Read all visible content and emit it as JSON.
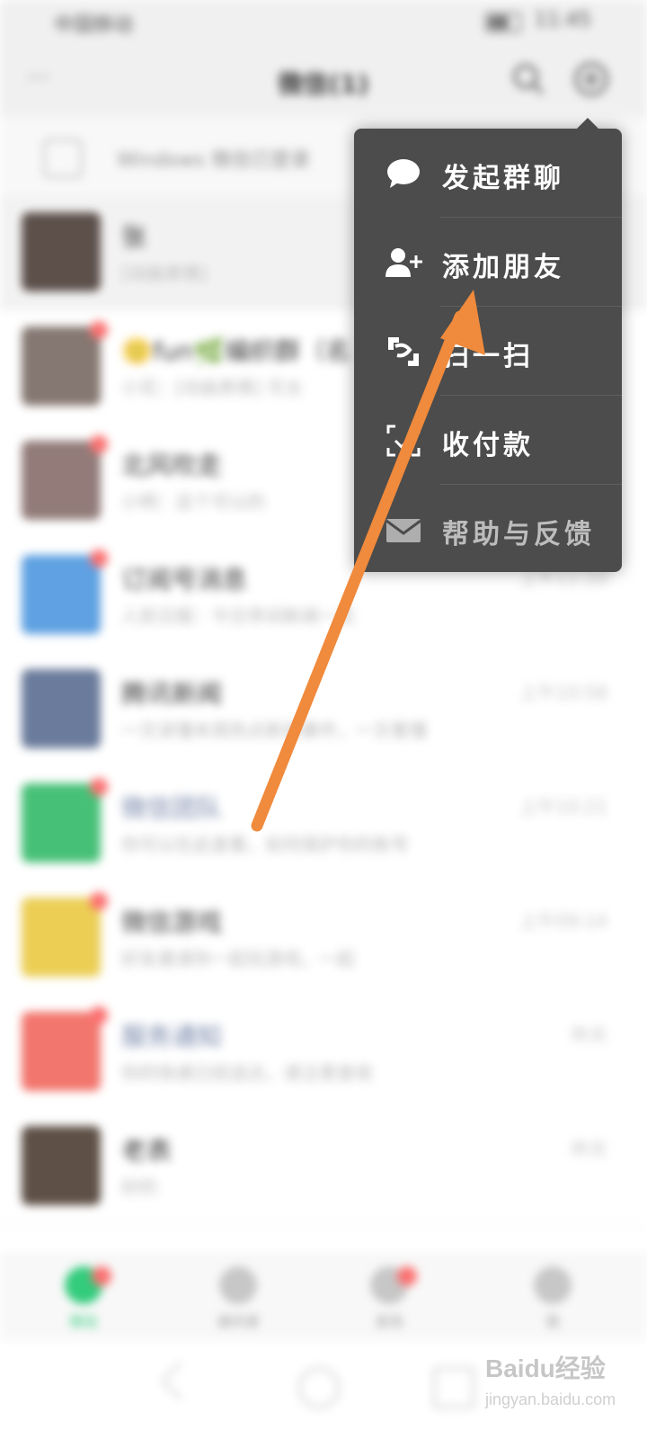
{
  "status_bar": {
    "carrier": "中国移动",
    "time": "11:45"
  },
  "header": {
    "title": "微信(1)",
    "search_icon": "search-icon",
    "add_icon": "plus-circle-icon"
  },
  "banner": {
    "text": "Windows 微信已登录"
  },
  "chats": [
    {
      "name": "张",
      "preview": "[动画表情]",
      "time": "",
      "avatar_color": "#3a2a24",
      "badge": false
    },
    {
      "name": "🙂fun🌿编织群（名",
      "preview": "小花：[动画表情] 可太",
      "time": "",
      "avatar_color": "#6b5a52",
      "badge": true
    },
    {
      "name": "北风吹走",
      "preview": "小明：这个可以的",
      "time": "",
      "avatar_color": "#7a5f5c",
      "badge": true
    },
    {
      "name": "订阅号消息",
      "preview": "人民日报：今日早间新闻一览",
      "time": "上午11:20",
      "avatar_color": "#3c8ddc",
      "badge": true
    },
    {
      "name": "腾讯新闻",
      "preview": "一文读懂本周热点新闻事件，一文看懂",
      "time": "上午10:58",
      "avatar_color": "#4a5f86",
      "badge": false
    },
    {
      "name": "微信团队",
      "preview": "你可以在此查看，如何保护你的账号",
      "time": "上午10:21",
      "avatar_color": "#1fb35a",
      "badge": true
    },
    {
      "name": "微信游戏",
      "preview": "好友邀请你一起玩游戏，一起",
      "time": "上午09:14",
      "avatar_color": "#e8c430",
      "badge": true
    },
    {
      "name": "服务通知",
      "preview": "你的快递已经送达，请注意查收",
      "time": "昨天",
      "avatar_color": "#f0584e",
      "badge": true
    },
    {
      "name": "老表",
      "preview": "好的",
      "time": "昨天",
      "avatar_color": "#3b2a1e",
      "badge": false
    }
  ],
  "tab_bar": {
    "tabs": [
      {
        "label": "微信",
        "icon": "chat-bubble-icon",
        "active": true,
        "dot": true
      },
      {
        "label": "通讯录",
        "icon": "contacts-icon",
        "active": false,
        "dot": false
      },
      {
        "label": "发现",
        "icon": "compass-icon",
        "active": false,
        "dot": true
      },
      {
        "label": "我",
        "icon": "person-icon",
        "active": false,
        "dot": false
      }
    ]
  },
  "popup_menu": {
    "items": [
      {
        "label": "发起群聊",
        "icon": "group-chat-icon"
      },
      {
        "label": "添加朋友",
        "icon": "add-friend-icon"
      },
      {
        "label": "扫一扫",
        "icon": "scan-icon"
      },
      {
        "label": "收付款",
        "icon": "payment-icon"
      },
      {
        "label": "帮助与反馈",
        "icon": "mail-icon"
      }
    ]
  },
  "watermark": {
    "logo": "Baidu经验",
    "url": "jingyan.baidu.com"
  },
  "colors": {
    "popup_bg": "#4c4c4c",
    "arrow": "#f08a3c",
    "accent_green": "#07c160",
    "badge_red": "#fa5151"
  }
}
